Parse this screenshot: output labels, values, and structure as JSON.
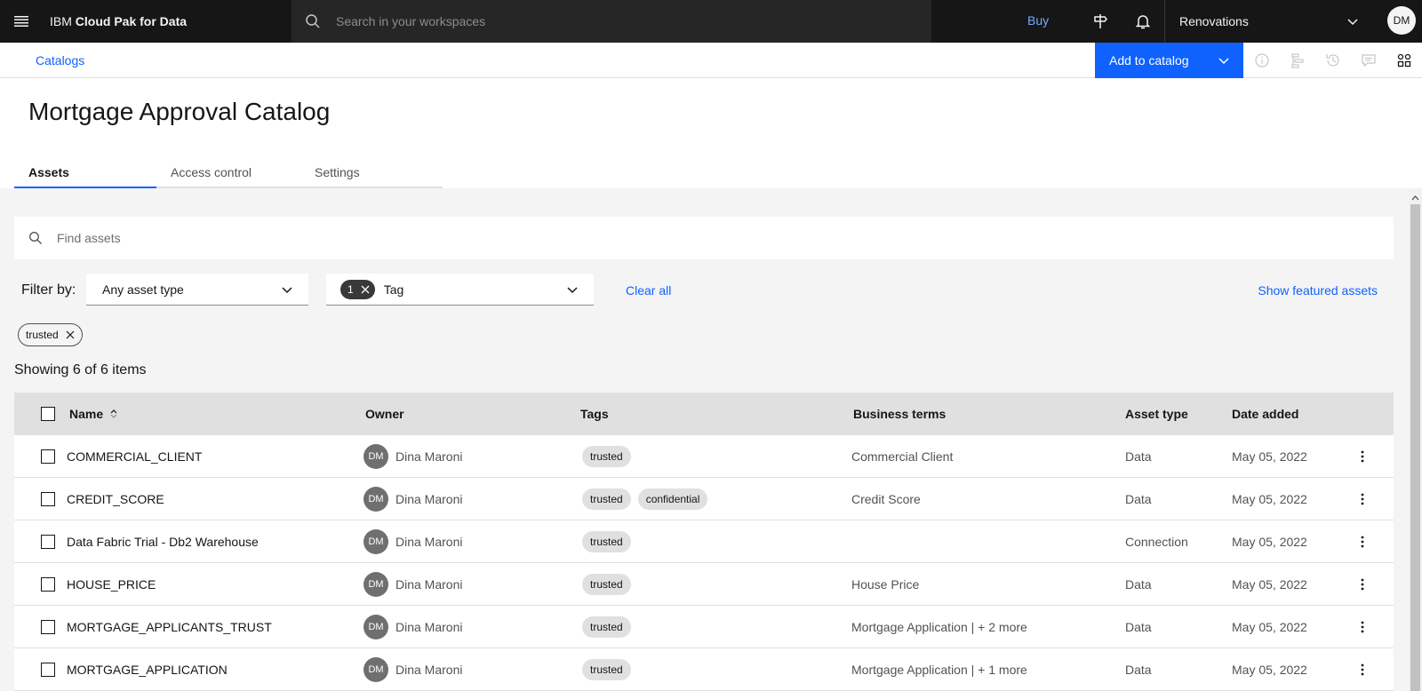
{
  "topbar": {
    "brand_prefix": "IBM",
    "brand_product": "Cloud Pak for Data",
    "search_placeholder": "Search in your workspaces",
    "buy_label": "Buy",
    "account_name": "Renovations",
    "avatar_initials": "DM"
  },
  "subbar": {
    "breadcrumb": "Catalogs",
    "add_button_label": "Add to catalog"
  },
  "page": {
    "title": "Mortgage Approval Catalog",
    "tabs": [
      {
        "label": "Assets",
        "active": true
      },
      {
        "label": "Access control",
        "active": false
      },
      {
        "label": "Settings",
        "active": false
      }
    ]
  },
  "filters": {
    "find_placeholder": "Find assets",
    "filter_by_label": "Filter by:",
    "asset_type_value": "Any asset type",
    "tag_count": "1",
    "tag_label": "Tag",
    "clear_all": "Clear all",
    "show_featured": "Show featured assets",
    "active_tag": "trusted"
  },
  "results": {
    "showing_text": "Showing 6 of 6 items"
  },
  "table": {
    "headers": {
      "name": "Name",
      "owner": "Owner",
      "tags": "Tags",
      "business_terms": "Business terms",
      "asset_type": "Asset type",
      "date_added": "Date added"
    },
    "rows": [
      {
        "name": "COMMERCIAL_CLIENT",
        "owner_initials": "DM",
        "owner": "Dina Maroni",
        "tags": [
          "trusted"
        ],
        "terms": "Commercial Client",
        "type": "Data",
        "date": "May 05, 2022"
      },
      {
        "name": "CREDIT_SCORE",
        "owner_initials": "DM",
        "owner": "Dina Maroni",
        "tags": [
          "trusted",
          "confidential"
        ],
        "terms": "Credit Score",
        "type": "Data",
        "date": "May 05, 2022"
      },
      {
        "name": "Data Fabric Trial - Db2 Warehouse",
        "owner_initials": "DM",
        "owner": "Dina Maroni",
        "tags": [
          "trusted"
        ],
        "terms": "",
        "type": "Connection",
        "date": "May 05, 2022"
      },
      {
        "name": "HOUSE_PRICE",
        "owner_initials": "DM",
        "owner": "Dina Maroni",
        "tags": [
          "trusted"
        ],
        "terms": "House Price",
        "type": "Data",
        "date": "May 05, 2022"
      },
      {
        "name": "MORTGAGE_APPLICANTS_TRUST",
        "owner_initials": "DM",
        "owner": "Dina Maroni",
        "tags": [
          "trusted"
        ],
        "terms": "Mortgage Application | + 2 more",
        "type": "Data",
        "date": "May 05, 2022"
      },
      {
        "name": "MORTGAGE_APPLICATION",
        "owner_initials": "DM",
        "owner": "Dina Maroni",
        "tags": [
          "trusted"
        ],
        "terms": "Mortgage Application | + 1 more",
        "type": "Data",
        "date": "May 05, 2022"
      }
    ]
  },
  "colors": {
    "accent": "#0f62fe",
    "topbar_bg": "#161616",
    "link": "#0f62fe"
  }
}
